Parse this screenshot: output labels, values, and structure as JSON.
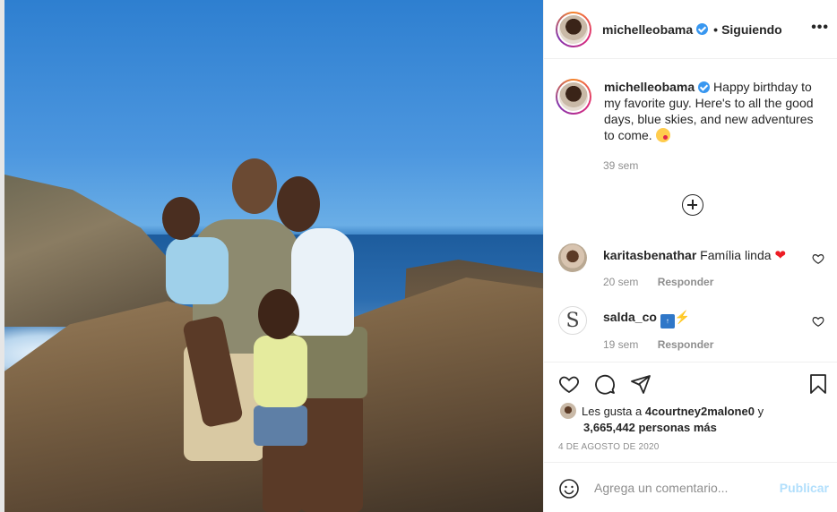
{
  "post": {
    "username": "michelleobama",
    "follow_status": "Siguiendo",
    "more_label": "•••",
    "caption": "Happy birthday to my favorite guy. Here's to all the good days, blue skies, and new adventures to come.",
    "caption_time": "39 sem"
  },
  "comments": [
    {
      "username": "karitasbenathar",
      "text": "Família linda",
      "emoji": "heart",
      "time": "20 sem",
      "reply_label": "Responder"
    },
    {
      "username": "salda_co",
      "text": "",
      "emoji": "top-zap",
      "time": "19 sem",
      "reply_label": "Responder"
    }
  ],
  "likes": {
    "prefix": "Les gusta a",
    "user": "4courtney2malone0",
    "and": "y",
    "others": "3,665,442 personas más"
  },
  "date": "4 DE AGOSTO DE 2020",
  "add_comment": {
    "placeholder": "Agrega un comentario...",
    "publish_label": "Publicar"
  },
  "colors": {
    "verified": "#3897f0",
    "publish_disabled": "#b2dffc",
    "muted_text": "#8e8e8e"
  }
}
